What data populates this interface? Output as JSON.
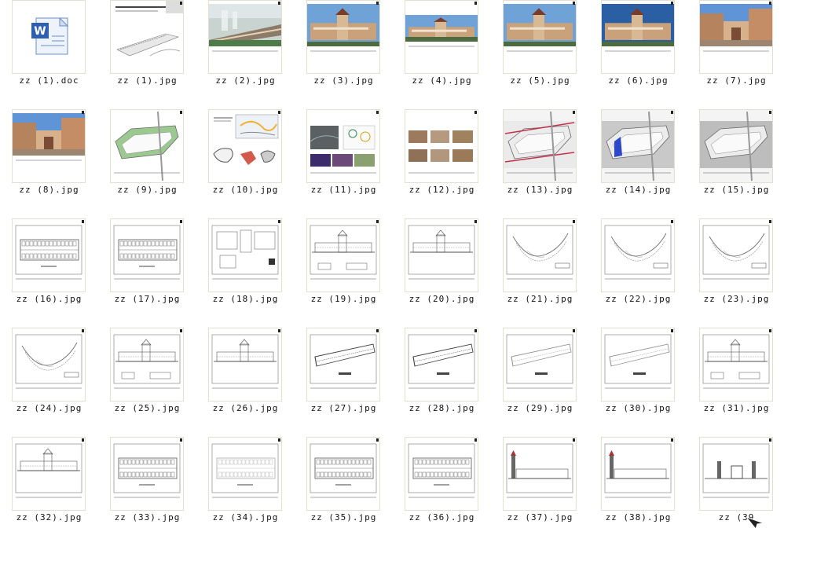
{
  "files": [
    {
      "name": "zz (1).doc",
      "kind": "doc"
    },
    {
      "name": "zz (1).jpg",
      "kind": "cover"
    },
    {
      "name": "zz (2).jpg",
      "kind": "aerial"
    },
    {
      "name": "zz (3).jpg",
      "kind": "render"
    },
    {
      "name": "zz (4).jpg",
      "kind": "render-wide"
    },
    {
      "name": "zz (5).jpg",
      "kind": "render"
    },
    {
      "name": "zz (6).jpg",
      "kind": "render-dark"
    },
    {
      "name": "zz (7).jpg",
      "kind": "render-street"
    },
    {
      "name": "zz (8).jpg",
      "kind": "render-street"
    },
    {
      "name": "zz (9).jpg",
      "kind": "site-green"
    },
    {
      "name": "zz (10).jpg",
      "kind": "location"
    },
    {
      "name": "zz (11).jpg",
      "kind": "photos"
    },
    {
      "name": "zz (12).jpg",
      "kind": "site-photos"
    },
    {
      "name": "zz (13).jpg",
      "kind": "site-roads"
    },
    {
      "name": "zz (14).jpg",
      "kind": "site-blue"
    },
    {
      "name": "zz (15).jpg",
      "kind": "site-gray"
    },
    {
      "name": "zz (16).jpg",
      "kind": "plan-rect"
    },
    {
      "name": "zz (17).jpg",
      "kind": "plan-rect"
    },
    {
      "name": "zz (18).jpg",
      "kind": "detail"
    },
    {
      "name": "zz (19).jpg",
      "kind": "elevation"
    },
    {
      "name": "zz (20).jpg",
      "kind": "elevation-single"
    },
    {
      "name": "zz (21).jpg",
      "kind": "plan-curve"
    },
    {
      "name": "zz (22).jpg",
      "kind": "plan-curve"
    },
    {
      "name": "zz (23).jpg",
      "kind": "plan-curve"
    },
    {
      "name": "zz (24).jpg",
      "kind": "plan-curve"
    },
    {
      "name": "zz (25).jpg",
      "kind": "elevation"
    },
    {
      "name": "zz (26).jpg",
      "kind": "elevation-single"
    },
    {
      "name": "zz (27).jpg",
      "kind": "plan-diagonal"
    },
    {
      "name": "zz (28).jpg",
      "kind": "plan-diagonal"
    },
    {
      "name": "zz (29).jpg",
      "kind": "plan-diagonal-light"
    },
    {
      "name": "zz (30).jpg",
      "kind": "plan-diagonal-light"
    },
    {
      "name": "zz (31).jpg",
      "kind": "elevation"
    },
    {
      "name": "zz (32).jpg",
      "kind": "elevation-long"
    },
    {
      "name": "zz (33).jpg",
      "kind": "plan-rect"
    },
    {
      "name": "zz (34).jpg",
      "kind": "plan-rect-light"
    },
    {
      "name": "zz (35).jpg",
      "kind": "plan-rect"
    },
    {
      "name": "zz (36).jpg",
      "kind": "plan-rect"
    },
    {
      "name": "zz (37).jpg",
      "kind": "elevation-tower"
    },
    {
      "name": "zz (38).jpg",
      "kind": "elevation-tower"
    },
    {
      "name": "zz (39",
      "kind": "elevation-towers"
    }
  ],
  "colors": {
    "thumb_border": "#e2dfd3",
    "label_text": "#111111",
    "background": "#ffffff"
  }
}
